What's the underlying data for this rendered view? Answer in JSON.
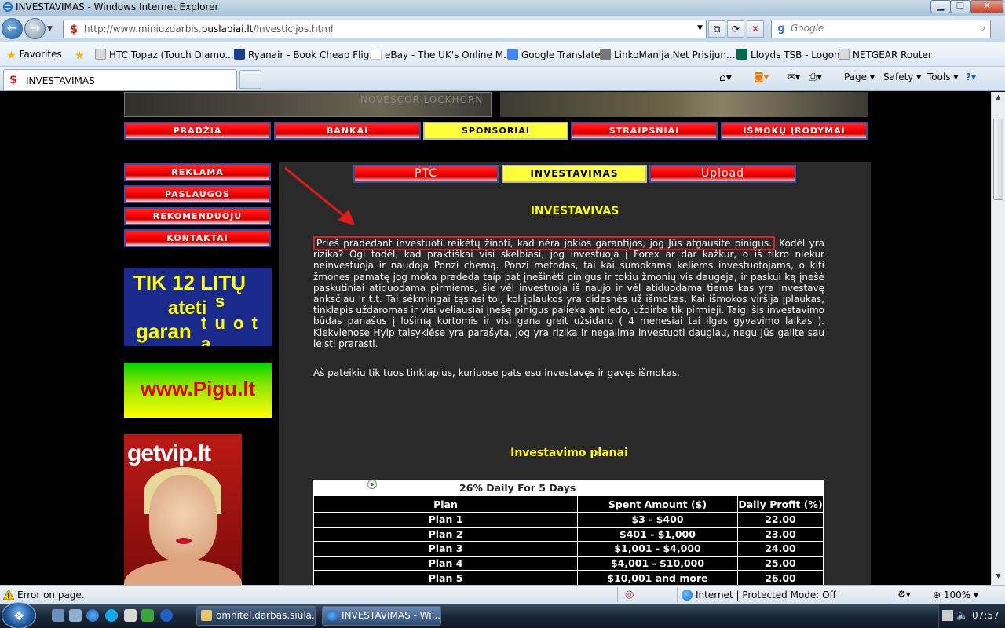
{
  "window": {
    "title": "INVESTAVIMAS - Windows Internet Explorer",
    "min_glyph": "▁",
    "max_glyph": "❐",
    "close_glyph": "✕"
  },
  "address_bar": {
    "url_prefix": "http://www.miniuzdarbis.",
    "url_domain": "puslapiai.lt",
    "url_suffix": "/Investicijos.html",
    "search_placeholder": "Google"
  },
  "favorites": {
    "favorites_label": "Favorites",
    "items": [
      {
        "label": "HTC Topaz (Touch Diamo...",
        "icon_color": "#d9d9d9"
      },
      {
        "label": "Ryanair - Book Cheap Flig...",
        "icon_color": "#1a3d8f"
      },
      {
        "label": "eBay - The UK's Online M...",
        "icon_color": "#e53238"
      },
      {
        "label": "Google Translate",
        "icon_color": "#4285f4"
      },
      {
        "label": "LinkoManija.Net  Prisijun...",
        "icon_color": "#777777"
      },
      {
        "label": "Lloyds TSB - Logon",
        "icon_color": "#006a4d"
      },
      {
        "label": "NETGEAR Router",
        "icon_color": "#d9d9d9"
      }
    ]
  },
  "tab": {
    "label": "INVESTAVIMAS",
    "icon_glyph": "$"
  },
  "command_bar": {
    "page": "Page ▾",
    "safety": "Safety ▾",
    "tools": "Tools ▾"
  },
  "page": {
    "top_nav": [
      "PRADŽIA",
      "BANKAI",
      "SPONSORIAI",
      "STRAIPSNIAI",
      "IŠMOKŲ ĮRODYMAI"
    ],
    "top_nav_active": "SPONSORIAI",
    "side_nav": [
      "REKLAMA",
      "PASLAUGOS",
      "REKOMENDUOJU",
      "KONTAKTAI"
    ],
    "sub_nav": [
      "PTC",
      "INVESTAVIMAS",
      "Upload"
    ],
    "sub_nav_active": "INVESTAVIMAS",
    "heading": "INVESTAVIVAS",
    "paragraph_highlight": "Prieš pradedant investuoti reikėtų žinoti, kad nėra jokios garantijos, jog Jūs atgausite pinigus.",
    "paragraph_rest": " Kodėl yra rizika? Ogi todėl, kad praktiškai visi skelbiasi, jog investuoja į Forex ar dar kažkur, o iš tikro niekur neinvestuoja ir naudoja Ponzi chemą. Ponzi metodas, tai kai sumokama keliems investuotojams, o kiti žmones pamatę jog moka pradeda taip pat įnešinėti pinigus ir tokiu žmonių vis daugeja, ir paskui ką įnešė paskutiniai atiduodama pirmiems, šie vėl investuoja iš naujo ir vėl atiduodama tiems kas yra investavę anksčiau ir t.t. Tai sėkmingai tęsiasi tol, kol įplaukos yra didesnės už išmokas. Kai išmokos viršija įplaukas, tinklapis uždaromas ir visi vėliausiai įnešę pinigus palieka ant ledo, uždirba tik pirmieji. Taigi šis investavimo būdas panašus į lošimą kortomis ir visi gana greit užsidaro ( 4 mėnesiai tai ilgas gyvavimo laikas ). Kiekvienose Hyip taisyklėse yra parašyta, jog yra rizika ir negalima investuoti daugiau, negu Jūs galite sau leisti prarasti.",
    "paragraph2": "Aš pateikiu tik tuos tinklapius, kuriuose pats esu investavęs ir gavęs išmokas.",
    "plans_heading": "Investavimo planai",
    "plans": {
      "caption": "26% Daily For 5 Days",
      "headers": [
        "Plan",
        "Spent Amount ($)",
        "Daily Profit (%)"
      ],
      "rows": [
        [
          "Plan 1",
          "$3 - $400",
          "22.00"
        ],
        [
          "Plan 2",
          "$401 - $1,000",
          "23.00"
        ],
        [
          "Plan 3",
          "$1,001 - $4,000",
          "24.00"
        ],
        [
          "Plan 4",
          "$4,001 - $10,000",
          "25.00"
        ],
        [
          "Plan 5",
          "$10,001 and more",
          "26.00"
        ]
      ]
    },
    "ads": {
      "litu_line1": "TIK 12 LITŲ",
      "litu_line2": "ateti",
      "litu_line2b": "s",
      "litu_line3": "garan",
      "litu_line3b": "t u o t a",
      "pigu": "www.Pigu.lt",
      "getvip": "getvip.lt"
    },
    "colors": {
      "nav_red": "#ff0000",
      "nav_active": "#ffff3a",
      "heading_yellow": "#ffff00",
      "content_bg": "#2a2a2a"
    }
  },
  "status_bar": {
    "error_text": "Error on page.",
    "zone_text": "Internet | Protected Mode: Off",
    "zoom": "100%"
  },
  "taskbar": {
    "items": [
      {
        "label": "omnitel.darbas.siula...",
        "active": false
      },
      {
        "label": "INVESTAVIMAS - Wi...",
        "active": true
      }
    ],
    "clock": "07:57"
  }
}
